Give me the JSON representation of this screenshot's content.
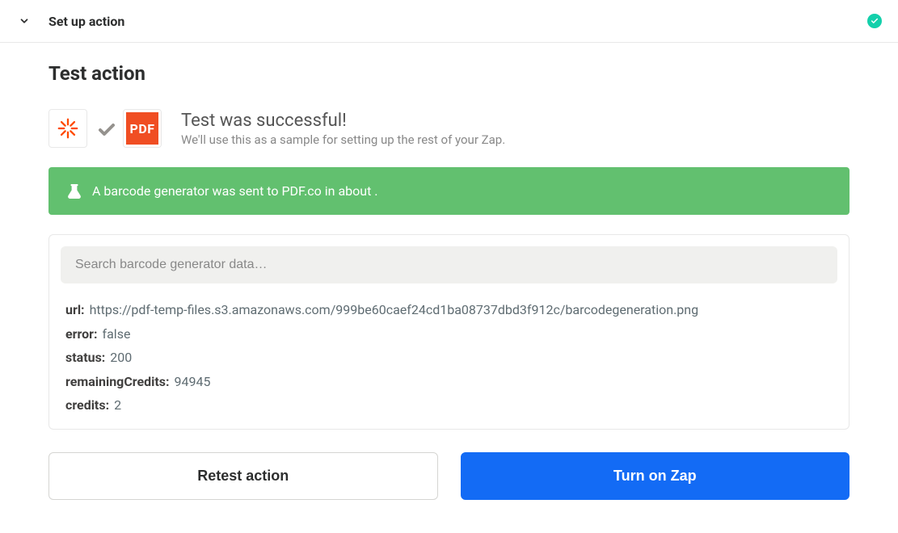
{
  "header": {
    "title": "Set up action"
  },
  "section": {
    "title": "Test action"
  },
  "result": {
    "heading": "Test was successful!",
    "subheading": "We'll use this as a sample for setting up the rest of your Zap."
  },
  "banner": {
    "text": "A barcode generator was sent to PDF.co in about ."
  },
  "search": {
    "placeholder": "Search barcode generator data…"
  },
  "response": [
    {
      "key": "url:",
      "value": "https://pdf-temp-files.s3.amazonaws.com/999be60caef24cd1ba08737dbd3f912c/barcodegeneration.png"
    },
    {
      "key": "error:",
      "value": "false"
    },
    {
      "key": "status:",
      "value": "200"
    },
    {
      "key": "remainingCredits:",
      "value": "94945"
    },
    {
      "key": "credits:",
      "value": "2"
    }
  ],
  "buttons": {
    "retest": "Retest action",
    "turn_on": "Turn on Zap"
  },
  "icons": {
    "pdf_label": "PDF"
  }
}
